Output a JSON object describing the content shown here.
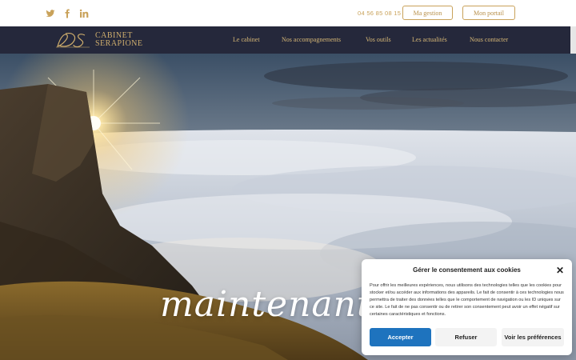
{
  "topbar": {
    "social": [
      {
        "name": "twitter-icon"
      },
      {
        "name": "facebook-icon"
      },
      {
        "name": "linkedin-icon"
      }
    ],
    "phone": "04 56 85 08 15",
    "buttons": [
      {
        "label": "Ma gestion"
      },
      {
        "label": "Mon portail"
      }
    ],
    "accent": "#c9a25a"
  },
  "nav": {
    "logo_line1": "CABINET",
    "logo_line2": "SERAPIONE",
    "menu": [
      {
        "label": "Le cabinet"
      },
      {
        "label": "Nos accompagnements"
      },
      {
        "label": "Vos outils"
      },
      {
        "label": "Les actualités"
      },
      {
        "label": "Nous contacter"
      }
    ],
    "background": "#25283b"
  },
  "hero": {
    "title": "maintenant"
  },
  "consent": {
    "title": "Gérer le consentement aux cookies",
    "body": "Pour offrir les meilleures expériences, nous utilisons des technologies telles que les cookies pour stocker et/ou accéder aux informations des appareils. Le fait de consentir à ces technologies nous permettra de traiter des données telles que le comportement de navigation ou les ID uniques sur ce site. Le fait de ne pas consentir ou de retirer son consentement peut avoir un effet négatif sur certaines caractéristiques et fonctions.",
    "accept": "Accepter",
    "refuse": "Refuser",
    "preferences": "Voir les préférences",
    "accept_color": "#1e73be"
  }
}
